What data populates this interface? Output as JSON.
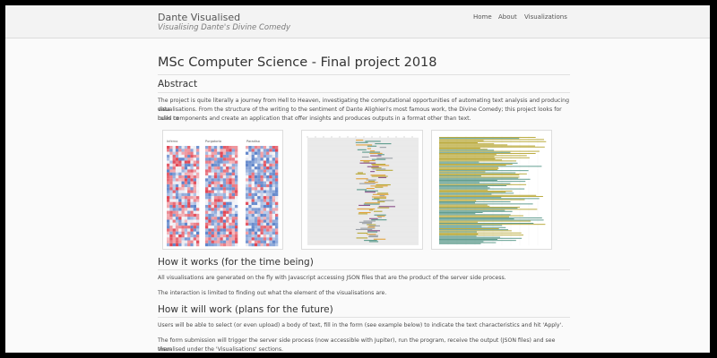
{
  "navbar": {
    "brand_title": "Dante Visualised",
    "brand_subtitle": "Visualising Dante's Divine Comedy",
    "links": [
      "Home",
      "About",
      "Visualizations"
    ]
  },
  "main": {
    "page_title": "MSc Computer Science - Final project 2018",
    "abstract_heading": "Abstract",
    "abstract_line1": "The project is quite literally a journey from Hell to Heaven, investigating the computational opportunities of automating text analysis and producing data",
    "abstract_line2": "visualisations. From the structure of the writing to the sentiment of Dante Alighieri's most famous work, the Divine Comedy; this project looks for rules to",
    "abstract_line3": "build components and create an application that offer insights and produces outputs in a format other than text.",
    "heatmap_panel_labels": [
      "Inferno",
      "Purgatorio",
      "Paradiso"
    ],
    "how_works_heading": "How it works (for the time being)",
    "how_works_p1": "All visualisations are generated on the fly with Javascript accessing JSON files that are the product of the server side process.",
    "how_works_p2": "The interaction is limited to finding out what the element of the visualisations are.",
    "how_will_heading": "How it will work (plans for the future)",
    "how_will_p1": "Users will be able to select (or even upload) a body of text, fill in the form (see example below) to indicate the text characteristics and hit 'Apply'.",
    "how_will_p2_line1": "The form submission will trigger the server side process (now accessible with Jupiter), run the program, receive the output (JSON files) and see them",
    "how_will_p2_line2": "visualised under the 'Visualisations' sections."
  },
  "colors": {
    "heat_red": "#e0414f",
    "heat_blue": "#5b82c9",
    "heat_neutral": "#e8e8f0",
    "bar_olive": "#b8a838",
    "bar_teal": "#5b9a8b",
    "bar_grey": "#9aa0a6",
    "bar_purple": "#8a4f8a",
    "bar_orange": "#e2a23b"
  }
}
